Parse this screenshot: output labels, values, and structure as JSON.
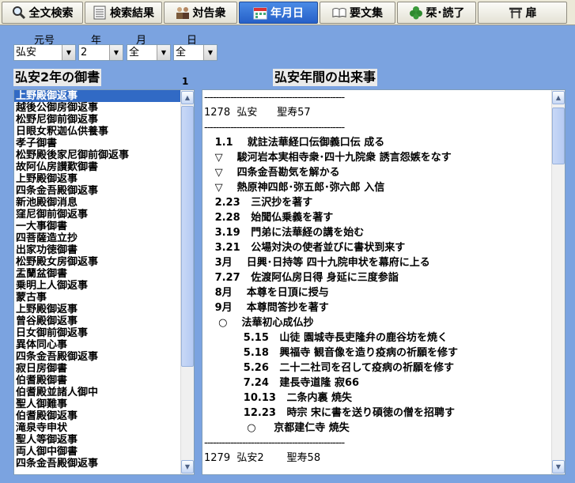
{
  "toolbar": {
    "tabs": [
      {
        "label": "全文検索",
        "icon": "magnifier-icon"
      },
      {
        "label": "検索結果",
        "icon": "document-list-icon"
      },
      {
        "label": "対告衆",
        "icon": "people-icon"
      },
      {
        "label": "年月日",
        "icon": "calendar-icon",
        "active": true
      },
      {
        "label": "要文集",
        "icon": "open-book-icon"
      },
      {
        "label": "栞･読了",
        "icon": "bookmark-leaf-icon"
      },
      {
        "label": "扉",
        "icon": "torii-gate-icon"
      }
    ]
  },
  "selectors": {
    "era": {
      "label": "元号",
      "value": "弘安"
    },
    "year": {
      "label": "年",
      "value": "2"
    },
    "month": {
      "label": "月",
      "value": "全"
    },
    "day": {
      "label": "日",
      "value": "全"
    }
  },
  "left": {
    "heading": "弘安2年の御書",
    "count": "1",
    "items": [
      "上野殿御返事",
      "越後公御房御返事",
      "松野尼御前御返事",
      "日眼女釈迦仏供養事",
      "孝子御書",
      "松野殿後家尼御前御返事",
      "故阿仏房讃歎御書",
      "上野殿御返事",
      "四条金吾殿御返事",
      "新池殿御消息",
      "窪尼御前御返事",
      "一大事御書",
      "四菩薩造立抄",
      "出家功徳御書",
      "松野殿女房御返事",
      "盂蘭盆御書",
      "乗明上人御返事",
      "蒙古事",
      "上野殿御返事",
      "曾谷殿御返事",
      "日女御前御返事",
      "異体同心事",
      "四条金吾殿御返事",
      "寂日房御書",
      "伯耆殿御書",
      "伯耆殿並諸人御中",
      "聖人御難事",
      "伯耆殿御返事",
      "滝泉寺申状",
      "聖人等御返事",
      "両人御中御書",
      "四条金吾殿御返事"
    ],
    "selected_index": 0
  },
  "right": {
    "heading": "弘安年間の出来事",
    "lines": [
      {
        "kind": "sep",
        "text": "------------------------------------------------"
      },
      {
        "kind": "year",
        "text": "1278  弘安      聖寿57"
      },
      {
        "kind": "sep",
        "text": "------------------------------------------------"
      },
      {
        "kind": "event",
        "text": "   1.1    就註法華経口伝御義口伝 成る"
      },
      {
        "kind": "event",
        "text": "   ▽    駿河岩本実相寺衆･四十九院衆 誘言怨嫉をなす"
      },
      {
        "kind": "event",
        "text": "   ▽    四条金吾勘気を解かる"
      },
      {
        "kind": "event",
        "text": "   ▽    熱原神四郎･弥五郎･弥六郎 入信"
      },
      {
        "kind": "event",
        "text": "   2.23   三沢抄を著す"
      },
      {
        "kind": "event",
        "text": "   2.28   始聞仏乗義を著す"
      },
      {
        "kind": "event",
        "text": "   3.19   門弟に法華経の講を始む"
      },
      {
        "kind": "event",
        "text": "   3.21   公場対決の使者並びに書状到来す"
      },
      {
        "kind": "event",
        "text": "   3月    日興･日持等 四十九院申状を幕府に上る"
      },
      {
        "kind": "event",
        "text": "   7.27   佐渡阿仏房日得 身延に三度参詣"
      },
      {
        "kind": "event",
        "text": "   8月    本尊を日頂に授与"
      },
      {
        "kind": "event",
        "text": "   9月    本尊問答抄を著す"
      },
      {
        "kind": "event",
        "text": "    ○    法華初心成仏抄"
      },
      {
        "kind": "event",
        "text": "           5.15   山徒 園城寺長吏隆弁の鹿谷坊を焼く"
      },
      {
        "kind": "event",
        "text": "           5.18   興福寺 観音像を造り疫病の祈願を修す"
      },
      {
        "kind": "event",
        "text": "           5.26   二十二社司を召して疫病の祈願を修す"
      },
      {
        "kind": "event",
        "text": "           7.24   建長寺道隆 寂66"
      },
      {
        "kind": "event",
        "text": "           10.13   二条内裏 焼失"
      },
      {
        "kind": "event",
        "text": "           12.23   時宗 宋に書を送り碩徳の僧を招聘す"
      },
      {
        "kind": "event",
        "text": "            ○     京都建仁寺 焼失"
      },
      {
        "kind": "sep",
        "text": "------------------------------------------------"
      },
      {
        "kind": "year",
        "text": "1279  弘安2       聖寿58"
      }
    ]
  }
}
